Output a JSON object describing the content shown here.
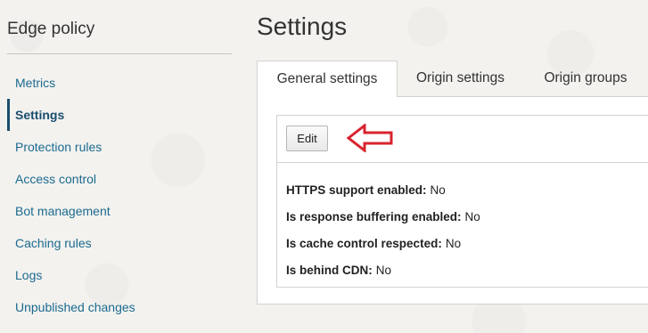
{
  "sidebar": {
    "title": "Edge policy",
    "items": [
      {
        "label": "Metrics"
      },
      {
        "label": "Settings",
        "active": true
      },
      {
        "label": "Protection rules"
      },
      {
        "label": "Access control"
      },
      {
        "label": "Bot management"
      },
      {
        "label": "Caching rules"
      },
      {
        "label": "Logs"
      },
      {
        "label": "Unpublished changes"
      }
    ]
  },
  "main": {
    "title": "Settings",
    "tabs": [
      {
        "label": "General settings",
        "active": true
      },
      {
        "label": "Origin settings"
      },
      {
        "label": "Origin groups"
      }
    ],
    "toolbar": {
      "edit_label": "Edit",
      "annotation": "red-arrow-icon"
    },
    "details": [
      {
        "label": "HTTPS support enabled:",
        "value": "No"
      },
      {
        "label": "Is response buffering enabled:",
        "value": "No"
      },
      {
        "label": "Is cache control respected:",
        "value": "No"
      },
      {
        "label": "Is behind CDN:",
        "value": "No"
      }
    ]
  },
  "colors": {
    "link": "#1b6a8f",
    "active_link": "#1a4d6e",
    "arrow": "#d9232e",
    "background": "#f3f2ef"
  }
}
